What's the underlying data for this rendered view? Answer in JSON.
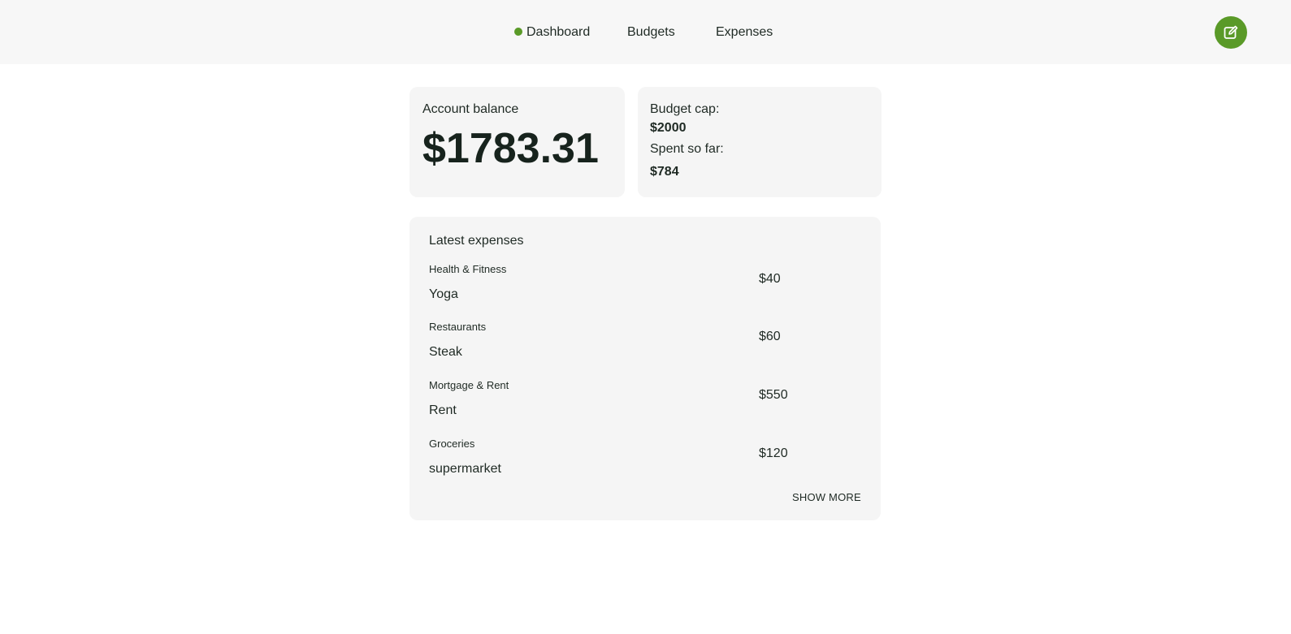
{
  "nav": {
    "dashboard": "Dashboard",
    "budgets": "Budgets",
    "expenses": "Expenses",
    "active_indicator_color": "#5a9a28",
    "edit_icon": "edit-icon"
  },
  "balance": {
    "label": "Account balance",
    "value": "$1783.31"
  },
  "budget": {
    "cap_label": "Budget cap:",
    "cap_value": "$2000",
    "spent_label": "Spent so far:",
    "spent_value": "$784"
  },
  "expenses": {
    "title": "Latest expenses",
    "items": [
      {
        "category": "Health & Fitness",
        "name": "Yoga",
        "amount": "$40"
      },
      {
        "category": "Restaurants",
        "name": "Steak",
        "amount": "$60"
      },
      {
        "category": "Mortgage & Rent",
        "name": "Rent",
        "amount": "$550"
      },
      {
        "category": "Groceries",
        "name": "supermarket",
        "amount": "$120"
      }
    ],
    "show_more": "SHOW MORE"
  },
  "colors": {
    "accent": "#5a9a28",
    "card_bg": "#f5f5f5",
    "header_bg": "#f7f7f7"
  }
}
